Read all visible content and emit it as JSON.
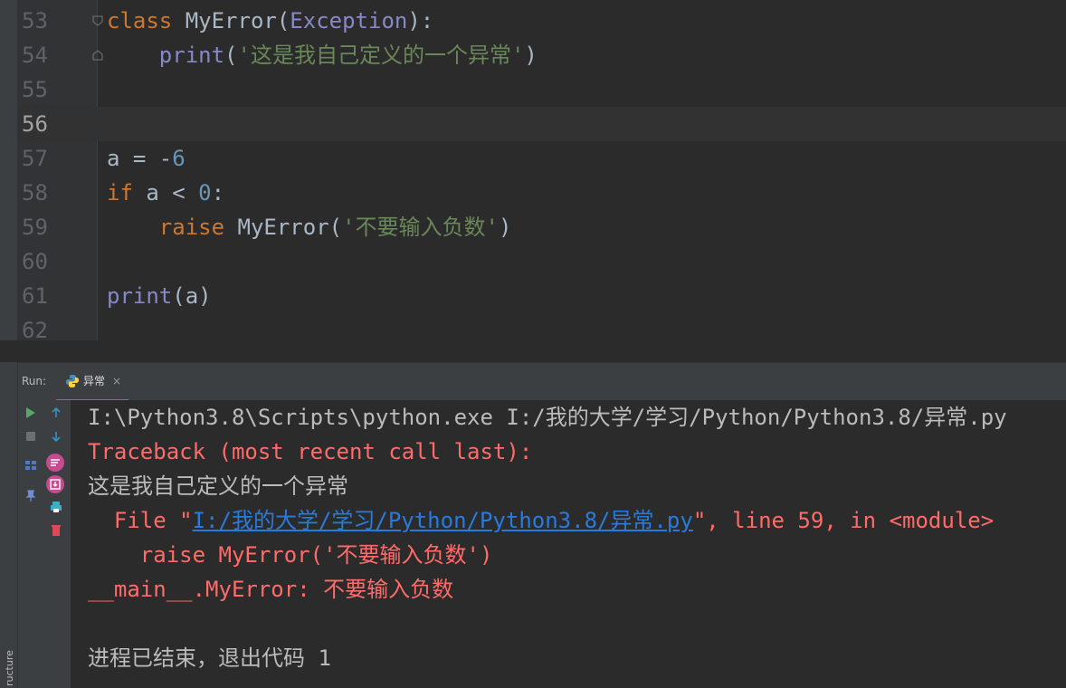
{
  "editor": {
    "current_line": "56",
    "lines": [
      {
        "n": "53",
        "tokens": [
          [
            "kw",
            "class "
          ],
          [
            "txt",
            "MyError("
          ],
          [
            "fn",
            "Exception"
          ],
          [
            "txt",
            "):"
          ]
        ]
      },
      {
        "n": "54",
        "tokens": [
          [
            "txt",
            "    "
          ],
          [
            "fn",
            "print"
          ],
          [
            "txt",
            "("
          ],
          [
            "str",
            "'这是我自己定义的一个异常'"
          ],
          [
            "txt",
            ")"
          ]
        ]
      },
      {
        "n": "55",
        "tokens": []
      },
      {
        "n": "56",
        "tokens": []
      },
      {
        "n": "57",
        "tokens": [
          [
            "txt",
            "a = -"
          ],
          [
            "num",
            "6"
          ]
        ]
      },
      {
        "n": "58",
        "tokens": [
          [
            "kw",
            "if "
          ],
          [
            "txt",
            "a < "
          ],
          [
            "num",
            "0"
          ],
          [
            "txt",
            ":"
          ]
        ]
      },
      {
        "n": "59",
        "tokens": [
          [
            "txt",
            "    "
          ],
          [
            "kw",
            "raise "
          ],
          [
            "txt",
            "MyError("
          ],
          [
            "str",
            "'不要输入负数'"
          ],
          [
            "txt",
            ")"
          ]
        ]
      },
      {
        "n": "60",
        "tokens": []
      },
      {
        "n": "61",
        "tokens": [
          [
            "fn",
            "print"
          ],
          [
            "txt",
            "(a)"
          ]
        ]
      },
      {
        "n": "62",
        "tokens": []
      }
    ]
  },
  "run_panel": {
    "label": "Run:",
    "tab_label": "异常",
    "tab_close": "×",
    "side_label": "ructure",
    "console_lines": [
      [
        [
          "c-normal",
          "I:\\Python3.8\\Scripts\\python.exe I:/我的大学/学习/Python/Python3.8/异常.py"
        ]
      ],
      [
        [
          "c-err",
          "Traceback (most recent call last):"
        ]
      ],
      [
        [
          "c-normal",
          "这是我自己定义的一个异常"
        ]
      ],
      [
        [
          "c-err",
          "  File \""
        ],
        [
          "c-link",
          "I:/我的大学/学习/Python/Python3.8/异常.py"
        ],
        [
          "c-err",
          "\", line 59, in <module>"
        ]
      ],
      [
        [
          "c-err",
          "    raise MyError('不要输入负数')"
        ]
      ],
      [
        [
          "c-err",
          "__main__.MyError: 不要输入负数"
        ]
      ],
      [],
      [
        [
          "c-normal",
          "进程已结束，退出代码 1"
        ]
      ]
    ]
  },
  "toolbar_icons": [
    "rerun-icon",
    "stop-icon",
    "layout-icon",
    "pin-icon",
    "up-arrow-icon",
    "down-arrow-icon",
    "soft-wrap-icon",
    "scroll-to-end-icon",
    "print-icon",
    "trash-icon"
  ],
  "colors": {
    "keyword": "#cc7832",
    "builtin": "#8888c6",
    "string": "#6a8759",
    "number": "#6897bb",
    "error": "#ff6b68",
    "link": "#287bde",
    "tab_accent": "#c74b8f"
  }
}
